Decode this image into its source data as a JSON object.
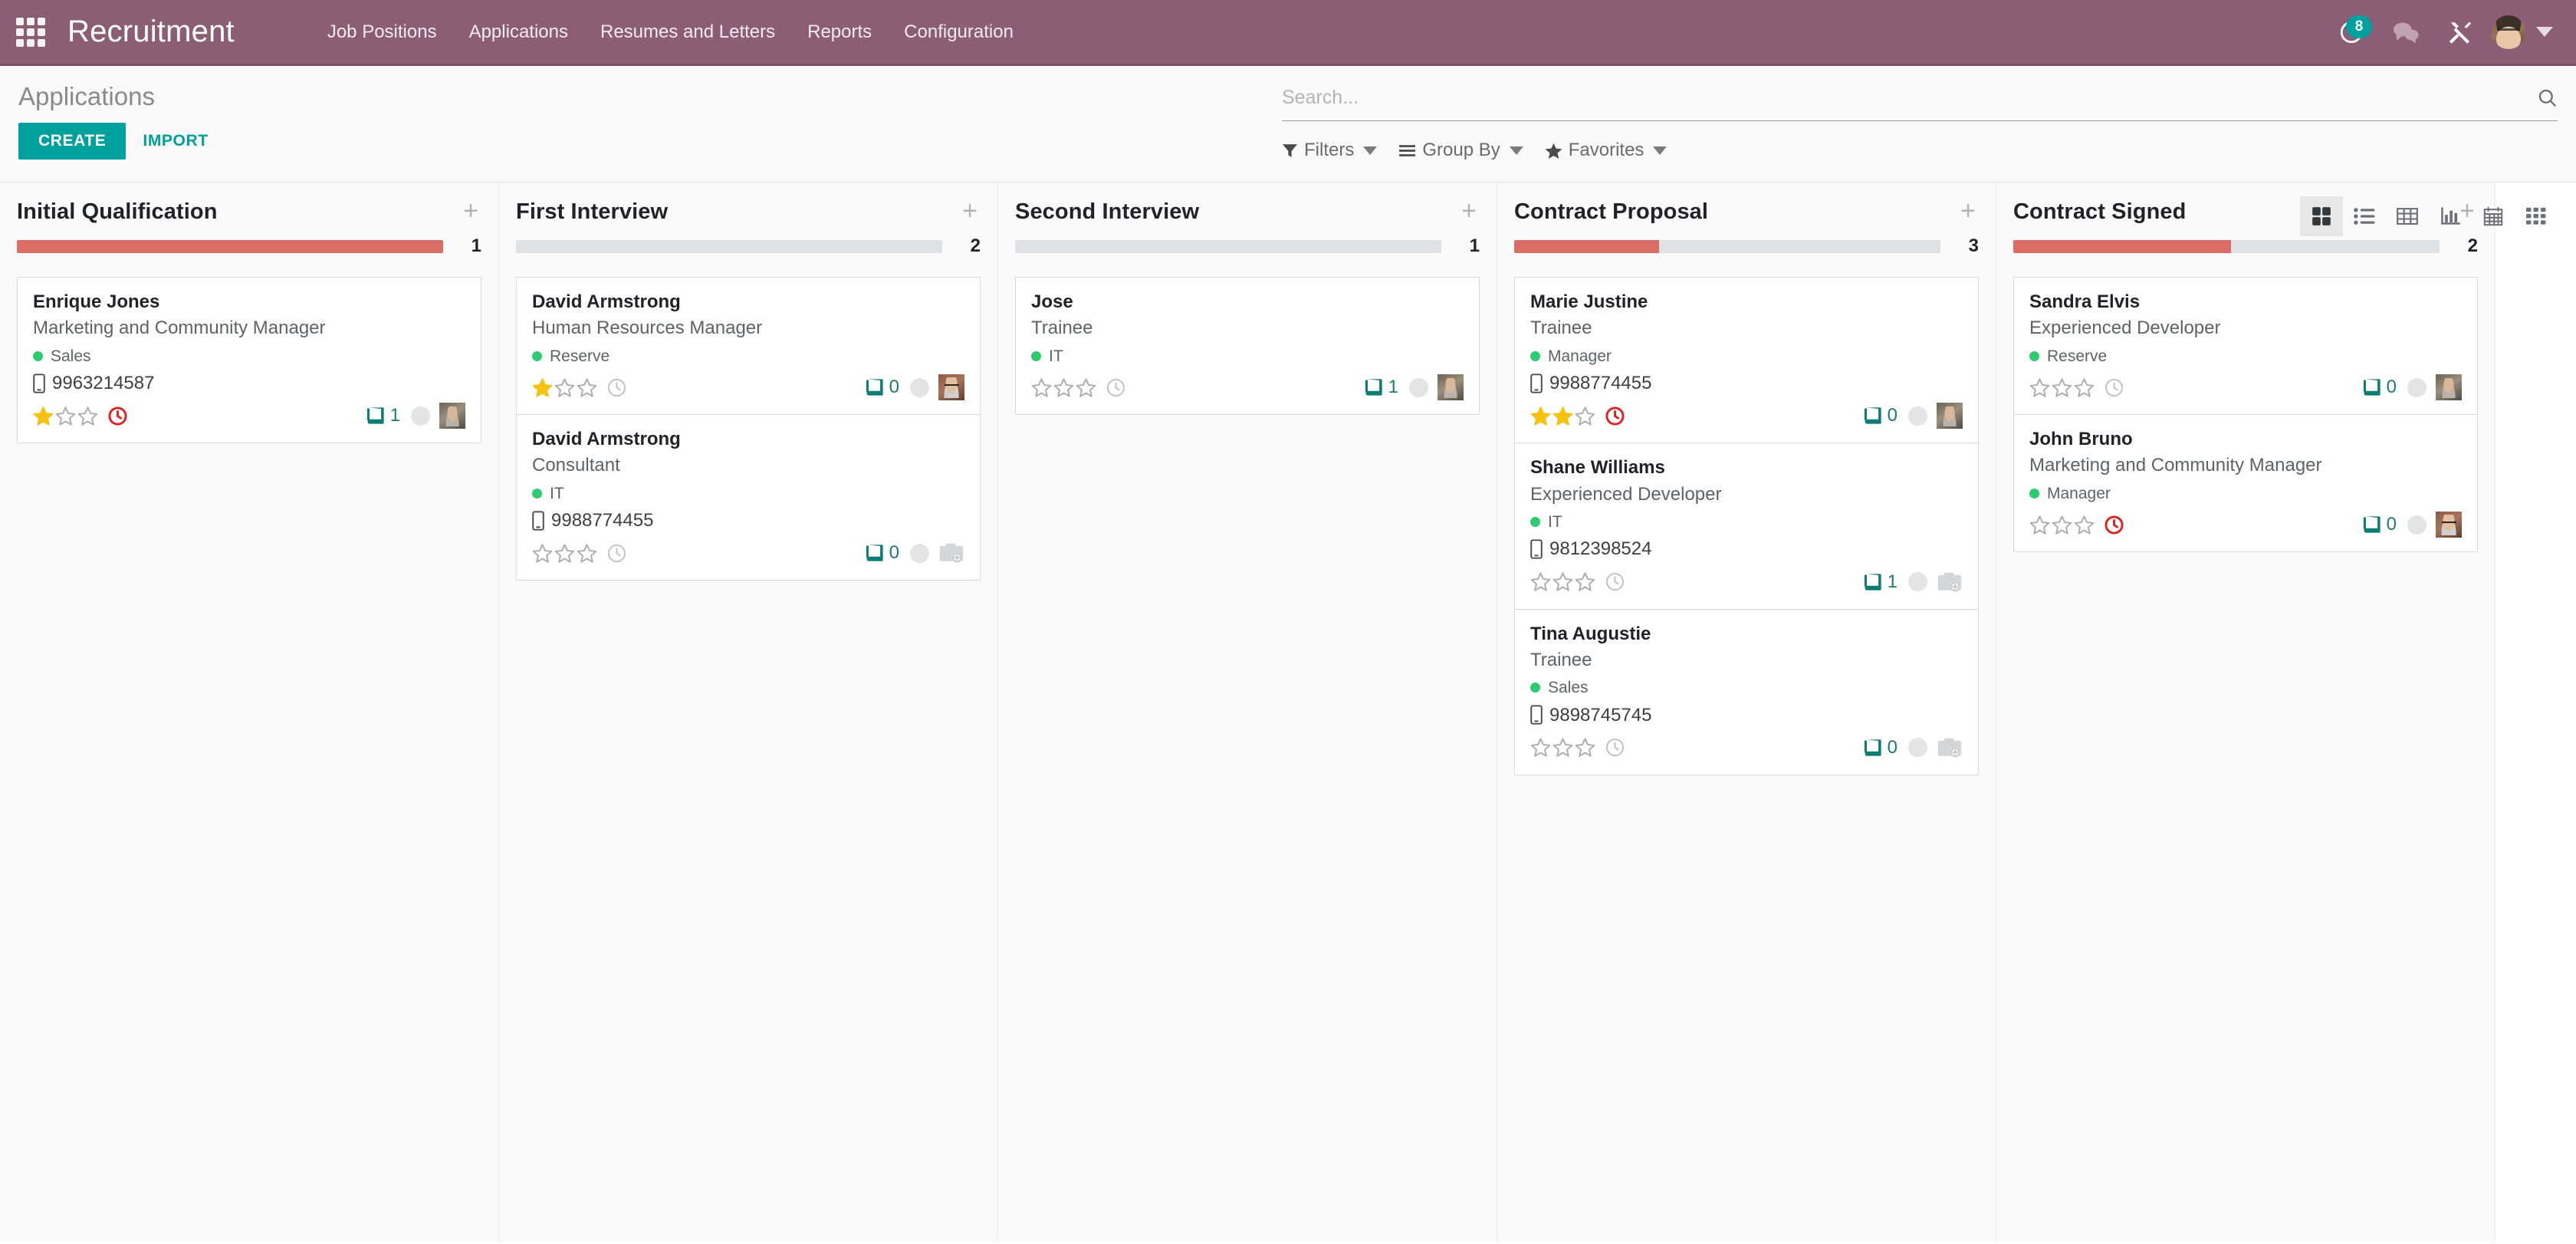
{
  "navbar": {
    "apps_icon": "apps-grid-icon",
    "brand": "Recruitment",
    "menu": [
      {
        "label": "Job Positions"
      },
      {
        "label": "Applications"
      },
      {
        "label": "Resumes and Letters"
      },
      {
        "label": "Reports"
      },
      {
        "label": "Configuration"
      }
    ],
    "activity_icon": "clock-icon",
    "activity_count": "8",
    "messages_icon": "chat-bubbles-icon",
    "tools_icon": "wrench-screwdriver-icon",
    "avatar_icon": "user-avatar",
    "user_caret_icon": "chevron-down-icon",
    "accent_color": "#8B5E75"
  },
  "control_panel": {
    "breadcrumb": "Applications",
    "create_label": "CREATE",
    "import_label": "IMPORT",
    "search_placeholder": "Search...",
    "search_value": "",
    "search_icon": "search-icon",
    "filters_label": "Filters",
    "filters_icon": "funnel-icon",
    "group_by_label": "Group By",
    "group_by_icon": "hamburger-lines-icon",
    "favorites_label": "Favorites",
    "favorites_icon": "star-icon",
    "views": [
      {
        "name": "kanban-view",
        "icon": "kanban-squares-icon",
        "active": true
      },
      {
        "name": "list-view",
        "icon": "list-icon",
        "active": false
      },
      {
        "name": "pivot-view",
        "icon": "table-grid-icon",
        "active": false
      },
      {
        "name": "graph-view",
        "icon": "bar-chart-icon",
        "active": false
      },
      {
        "name": "calendar-view",
        "icon": "calendar-icon",
        "active": false
      },
      {
        "name": "activity-view",
        "icon": "dot-matrix-icon",
        "active": false
      }
    ]
  },
  "kanban": {
    "add_column_icon": "plus-icon",
    "bar_color": "#DB6D64",
    "bar_track_color": "#DEE2E6",
    "columns": [
      {
        "title": "Initial Qualification",
        "count": "1",
        "progress_percent": 100,
        "cards": [
          {
            "name": "Enrique Jones",
            "job": "Marketing and Community Manager",
            "tag": "Sales",
            "phone": "9963214587",
            "stars_filled": 1,
            "stars_total": 3,
            "clock_state": "overdue",
            "log_count": "1",
            "avatar": "photo-a"
          }
        ]
      },
      {
        "title": "First Interview",
        "count": "2",
        "progress_percent": 0,
        "cards": [
          {
            "name": "David Armstrong",
            "job": "Human Resources Manager",
            "tag": "Reserve",
            "phone": "",
            "stars_filled": 1,
            "stars_total": 3,
            "clock_state": "normal",
            "log_count": "0",
            "avatar": "photo-b"
          },
          {
            "name": "David Armstrong",
            "job": "Consultant",
            "tag": "IT",
            "phone": "9988774455",
            "stars_filled": 0,
            "stars_total": 3,
            "clock_state": "normal",
            "log_count": "0",
            "avatar": "placeholder"
          }
        ]
      },
      {
        "title": "Second Interview",
        "count": "1",
        "progress_percent": 0,
        "cards": [
          {
            "name": "Jose",
            "job": "Trainee",
            "tag": "IT",
            "phone": "",
            "stars_filled": 0,
            "stars_total": 3,
            "clock_state": "normal",
            "log_count": "1",
            "avatar": "photo-a"
          }
        ]
      },
      {
        "title": "Contract Proposal",
        "count": "3",
        "progress_percent": 34,
        "cards": [
          {
            "name": "Marie Justine",
            "job": "Trainee",
            "tag": "Manager",
            "phone": "9988774455",
            "stars_filled": 2,
            "stars_total": 3,
            "clock_state": "overdue",
            "log_count": "0",
            "avatar": "photo-a"
          },
          {
            "name": "Shane Williams",
            "job": "Experienced Developer",
            "tag": "IT",
            "phone": "9812398524",
            "stars_filled": 0,
            "stars_total": 3,
            "clock_state": "normal",
            "log_count": "1",
            "avatar": "placeholder"
          },
          {
            "name": "Tina Augustie",
            "job": "Trainee",
            "tag": "Sales",
            "phone": "9898745745",
            "stars_filled": 0,
            "stars_total": 3,
            "clock_state": "normal",
            "log_count": "0",
            "avatar": "placeholder"
          }
        ]
      },
      {
        "title": "Contract Signed",
        "count": "2",
        "progress_percent": 51,
        "cards": [
          {
            "name": "Sandra Elvis",
            "job": "Experienced Developer",
            "tag": "Reserve",
            "phone": "",
            "stars_filled": 0,
            "stars_total": 3,
            "clock_state": "normal",
            "log_count": "0",
            "avatar": "photo-a"
          },
          {
            "name": "John Bruno",
            "job": "Marketing and Community Manager",
            "tag": "Manager",
            "phone": "",
            "stars_filled": 0,
            "stars_total": 3,
            "clock_state": "overdue",
            "log_count": "0",
            "avatar": "photo-b"
          }
        ]
      }
    ]
  }
}
